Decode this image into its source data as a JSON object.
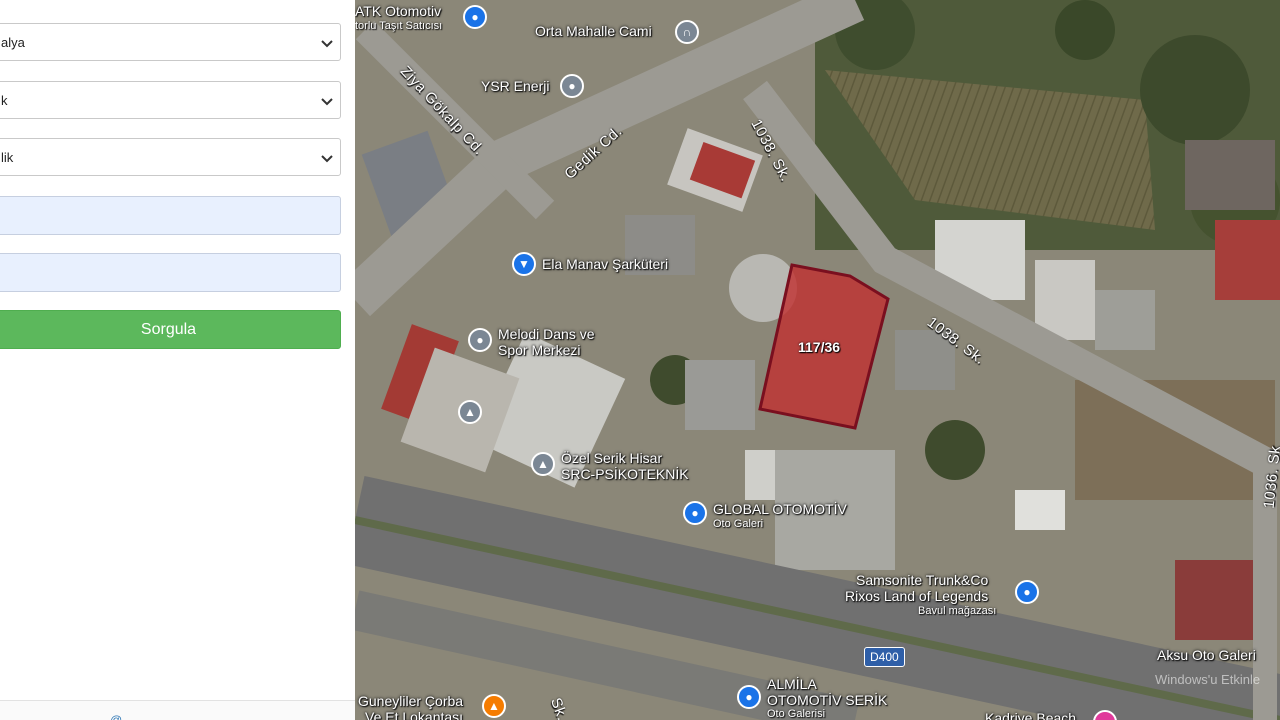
{
  "sidebar": {
    "selects": [
      {
        "value": "alya"
      },
      {
        "value": "k"
      },
      {
        "value": "lik"
      }
    ],
    "inputs": [
      {
        "value": ""
      },
      {
        "value": ""
      }
    ],
    "query_button": "Sorgula",
    "footer_text": "...@..."
  },
  "map": {
    "parcel_label": "117/36",
    "road_labels": {
      "ziya": "Ziya Gökalp Cd.",
      "gedik": "Gedik Cd.",
      "s1038a": "1038. Sk.",
      "s1038b": "1038. Sk.",
      "s1036": "1036. Sk",
      "sk": "Sk."
    },
    "route_shield": "D400",
    "places": [
      {
        "name": "ATK Otomotiv",
        "sub": "torlu Taşıt Satıcısı",
        "icon": "bag-icon"
      },
      {
        "name": "Orta Mahalle Cami",
        "icon": "mosque-icon"
      },
      {
        "name": "YSR Enerji",
        "icon": "pin-icon"
      },
      {
        "name": "Ela Manav Şarküteri",
        "icon": "cart-icon"
      },
      {
        "name": "Melodi Dans ve",
        "name2": "Spor Merkezi",
        "icon": "pin-icon"
      },
      {
        "name": "Özel Serik Hisar",
        "name2": "SRC-PSİKOTEKNİK",
        "icon": "school-icon"
      },
      {
        "name": "GLOBAL OTOMOTİV",
        "sub": "Oto Galeri",
        "icon": "bag-icon"
      },
      {
        "name": "Samsonite Trunk&Co",
        "name2": "Rixos Land of Legends",
        "sub": "Bavul mağazası",
        "icon": "bag-icon"
      },
      {
        "name": "Aksu Oto Galeri",
        "icon": "bag-icon"
      },
      {
        "name": "ALMİLA",
        "name2": "OTOMOTİV SERİK",
        "sub": "Oto Galerisi",
        "icon": "bag-icon"
      },
      {
        "name": "Guneyliler Çorba",
        "name2": "Ve Et Lokantası",
        "icon": "fork-icon"
      },
      {
        "name": "Kadriye Beach",
        "icon": "pin-icon"
      }
    ],
    "watermark": "Windows'u Etkinle"
  },
  "colors": {
    "button": "#5cb85c",
    "input_bg": "#e8f0fe",
    "parcel_fill": "#c0302f",
    "parcel_stroke": "#7a0f1f"
  }
}
